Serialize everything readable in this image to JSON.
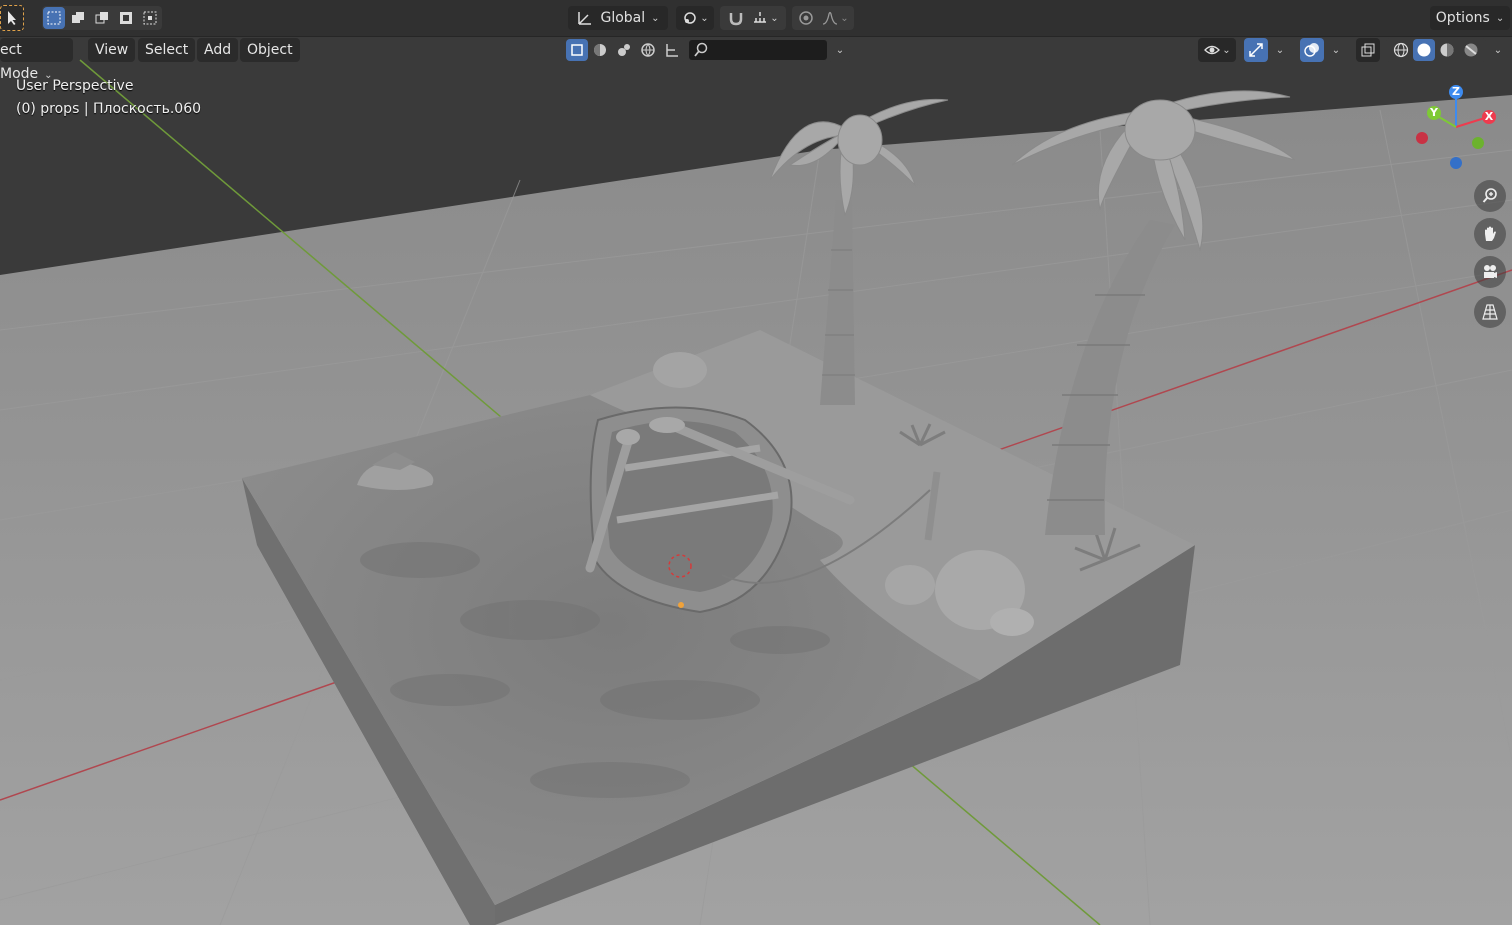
{
  "header": {
    "transform_orientation": "Global",
    "options_label": "Options"
  },
  "menubar": {
    "mode_label": "ect Mode",
    "items": [
      "View",
      "Select",
      "Add",
      "Object"
    ]
  },
  "viewport": {
    "perspective_label": "User Perspective",
    "object_info": "(0) props | Плоскость.060"
  },
  "gizmo": {
    "x_label": "X",
    "y_label": "Y",
    "z_label": "Z",
    "colors": {
      "x": "#ee3b4e",
      "y": "#7ec935",
      "z": "#3d8bf0"
    }
  },
  "icons": {
    "select_tool": "cursor-arrow-icon",
    "selection_modes": [
      "select-box-new-icon",
      "select-box-extend-icon",
      "select-box-subtract-icon",
      "select-box-invert-icon",
      "select-box-intersect-icon"
    ],
    "orientation": "transform-axes-icon",
    "pivot": "pivot-point-icon",
    "snap": "magnet-icon",
    "snap_target": "snap-increment-icon",
    "proportional": "proportional-edit-icon",
    "falloff": "falloff-curve-icon",
    "nav": [
      "zoom-icon",
      "hand-pan-icon",
      "camera-icon",
      "grid-perspective-icon"
    ],
    "shading": [
      "wireframe-shading-icon",
      "solid-shading-icon",
      "material-shading-icon",
      "rendered-shading-icon"
    ]
  },
  "accent_color": "#4772b3"
}
